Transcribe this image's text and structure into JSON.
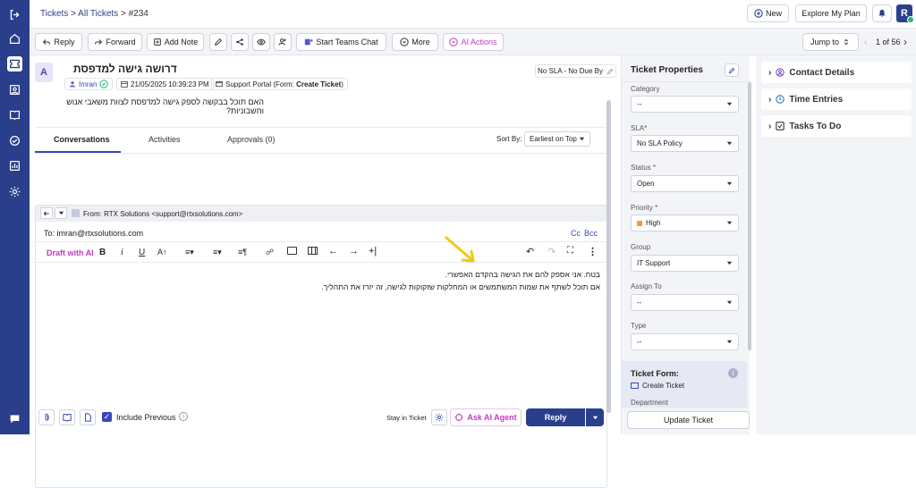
{
  "breadcrumb": {
    "tickets": "Tickets",
    "sep1": ">",
    "all": "All Tickets",
    "sep2": ">",
    "id": "#234"
  },
  "header": {
    "new_label": "New",
    "explore_label": "Explore My Plan",
    "avatar_letter": "R"
  },
  "toolbar": {
    "reply": "Reply",
    "forward": "Forward",
    "add_note": "Add Note",
    "teams": "Start Teams Chat",
    "more": "More",
    "ai_actions": "AI Actions",
    "jump_to": "Jump to",
    "pager": "1 of 56"
  },
  "ticket": {
    "avatar": "A",
    "subject": "דרושה גישה למדפסת",
    "user": "Imran",
    "date": "21/05/2025 10:39:23 PM",
    "source_prefix": "Support Portal (Form: ",
    "source_form": "Create Ticket",
    "source_suffix": ")",
    "sla": "No SLA - No Due By",
    "body": "האם תוכל בבקשה לספק גישה למדפסת לצוות משאבי אנוש וחשבוניות?"
  },
  "tabs": {
    "conversations": "Conversations",
    "activities": "Activities",
    "approvals": "Approvals (0)",
    "sort_label": "Sort By:",
    "sort_value": "Earliest on Top"
  },
  "composer": {
    "from": "From: RTX Solutions <support@rtxsolutions.com>",
    "to": "To: imran@rtxsolutions.com",
    "cc": "Cc",
    "bcc": "Bcc",
    "draft_ai": "Draft with AI",
    "line1": "בטח. אני אספק להם את הגישה בהקדם האפשרי.",
    "line2": "אם תוכל לשתף את שמות המשתמשים או המחלקות שזקוקות לגישה, זה יזרז את התהליך.",
    "include_previous": "Include Previous",
    "stay_in_ticket": "Stay in Ticket",
    "ask_ai": "Ask AI Agent",
    "reply": "Reply"
  },
  "properties": {
    "title": "Ticket Properties",
    "fields": [
      {
        "label": "Category",
        "value": "--"
      },
      {
        "label": "SLA*",
        "value": "No SLA Policy"
      },
      {
        "label": "Status *",
        "value": "Open"
      },
      {
        "label": "Priority *",
        "value": "High"
      },
      {
        "label": "Group",
        "value": "IT Support"
      },
      {
        "label": "Assign To",
        "value": "--"
      },
      {
        "label": "Type",
        "value": "--"
      }
    ],
    "form_title": "Ticket Form:",
    "form_value": "Create Ticket",
    "department": "Department",
    "update": "Update Ticket",
    "priority_color": "#f0a020"
  },
  "right_panel": {
    "contact": "Contact Details",
    "time": "Time Entries",
    "tasks": "Tasks To Do"
  },
  "colors": {
    "brand": "#2a3f8c",
    "accent": "#3a47b8",
    "ai": "#c23bc4",
    "arrow": "#f2c811"
  }
}
